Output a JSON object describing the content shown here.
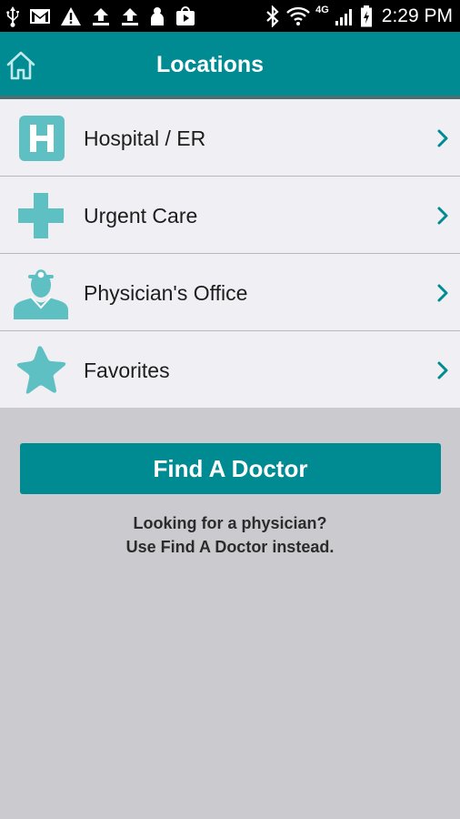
{
  "status_bar": {
    "time": "2:29 PM",
    "network": "4G"
  },
  "header": {
    "title": "Locations"
  },
  "locations": [
    {
      "label": "Hospital / ER",
      "icon": "hospital-icon"
    },
    {
      "label": "Urgent Care",
      "icon": "cross-icon"
    },
    {
      "label": "Physician's Office",
      "icon": "physician-icon"
    },
    {
      "label": "Favorites",
      "icon": "star-icon"
    }
  ],
  "find_doctor": {
    "button_label": "Find A Doctor",
    "hint_line1": "Looking for a physician?",
    "hint_line2": "Use Find A Doctor instead."
  },
  "colors": {
    "accent": "#008b93",
    "icon": "#5fc0c4",
    "list_bg": "#efeff4",
    "page_bg": "#cacacf"
  }
}
